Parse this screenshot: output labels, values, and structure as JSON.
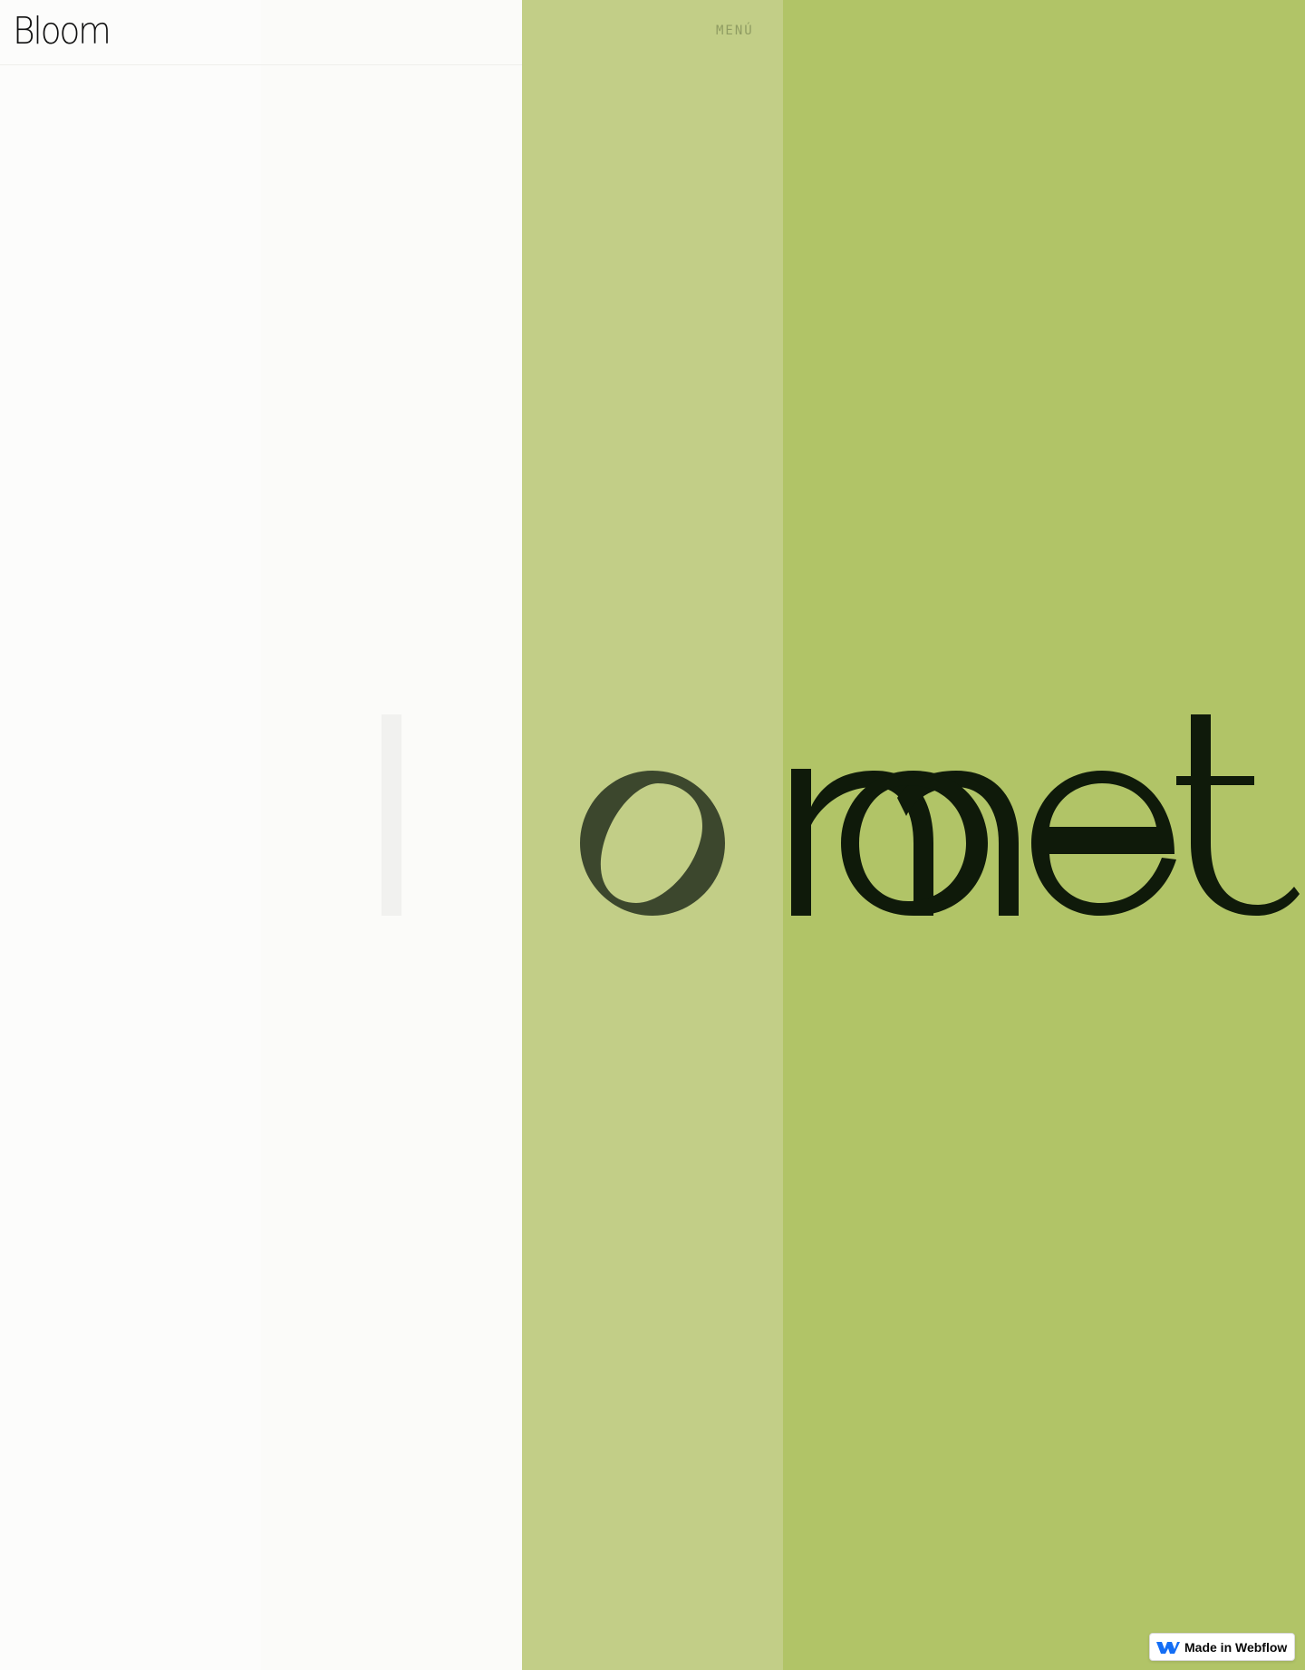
{
  "header": {
    "logo_text": "Bloom",
    "menu_label": "MENÚ"
  },
  "hero": {
    "letters": [
      "l",
      "o",
      "m",
      "e",
      "t"
    ]
  },
  "badge": {
    "label": "Made in Webflow",
    "icon": "webflow-logo-icon"
  },
  "colors": {
    "panel_light": "#fcfcfb",
    "panel_light_2": "#fbfbf9",
    "panel_green_light": "#c2ce87",
    "panel_green": "#b1c467",
    "text_dark": "#0f1a0a",
    "badge_blue": "#146ef5"
  }
}
